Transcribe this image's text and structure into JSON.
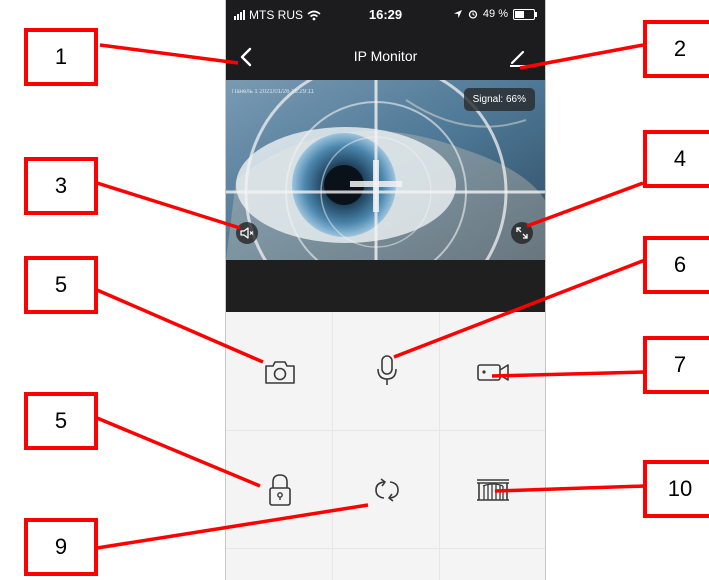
{
  "status_bar": {
    "carrier": "MTS RUS",
    "time": "16:29",
    "battery_pct": "49 %"
  },
  "nav": {
    "title": "IP Monitor",
    "back_icon": "chevron-left-icon",
    "edit_icon": "pencil-icon"
  },
  "video": {
    "overlay_text": "Панель 1  2021/01/26  16:29:11",
    "signal_label": "Signal: 66%"
  },
  "controls": [
    {
      "icon": "camera-icon"
    },
    {
      "icon": "microphone-icon"
    },
    {
      "icon": "video-record-icon"
    },
    {
      "icon": "lock-icon"
    },
    {
      "icon": "switch-camera-icon"
    },
    {
      "icon": "gate-icon"
    }
  ],
  "callouts": [
    "1",
    "2",
    "3",
    "4",
    "5",
    "6",
    "7",
    "5",
    "10",
    "9"
  ],
  "colors": {
    "annotation": "#ff0000",
    "nav_bg": "#1c1c1e",
    "controls_bg": "#f4f4f4",
    "icon_stroke": "#3a3a3a"
  }
}
